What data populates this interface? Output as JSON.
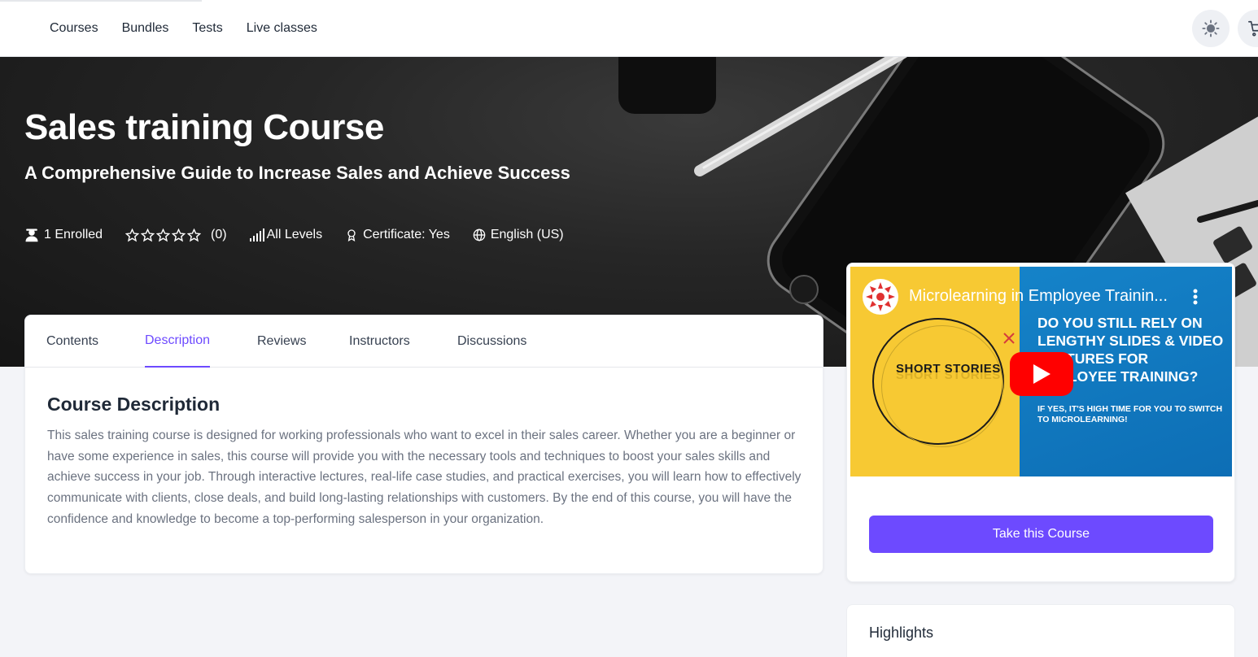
{
  "nav": {
    "links": [
      "Courses",
      "Bundles",
      "Tests",
      "Live classes"
    ],
    "icons": [
      "sun-icon",
      "cart-icon"
    ]
  },
  "course": {
    "title": "Sales training Course",
    "subtitle": "A Comprehensive Guide to Increase Sales and Achieve Success",
    "enrolled": "1 Enrolled",
    "rating_count": "(0)",
    "rating_stars": 0,
    "level": "All Levels",
    "certificate": "Certificate: Yes",
    "language": "English (US)"
  },
  "tabs": {
    "contents": "Contents",
    "description": "Description",
    "reviews": "Reviews",
    "instructors": "Instructors",
    "discussions": "Discussions",
    "active": "Description"
  },
  "description": {
    "heading": "Course Description",
    "text": "This sales training course is designed for working professionals who want to excel in their sales career. Whether you are a beginner or have some experience in sales, this course will provide you with the necessary tools and techniques to boost your sales skills and achieve success in your job. Through interactive lectures, real-life case studies, and practical exercises, you will learn how to effectively communicate with clients, close deals, and build long-lasting relationships with customers. By the end of this course, you will have the confidence and knowledge to become a top-performing salesperson in your organization."
  },
  "video": {
    "title": "Microlearning in Employee Trainin...",
    "thumb_left": "SHORT STORIES",
    "thumb_headline": "DO YOU STILL RELY ON LENGTHY SLIDES & VIDEO LECTURES FOR EMPLOYEE TRAINING?",
    "thumb_sub": "IF YES, IT'S HIGH TIME FOR YOU TO SWITCH TO MICROLEARNING!"
  },
  "sidebar": {
    "take_course": "Take this Course",
    "highlights": "Highlights"
  },
  "colors": {
    "accent": "#6d4aff",
    "youtube_red": "#ff0000"
  }
}
